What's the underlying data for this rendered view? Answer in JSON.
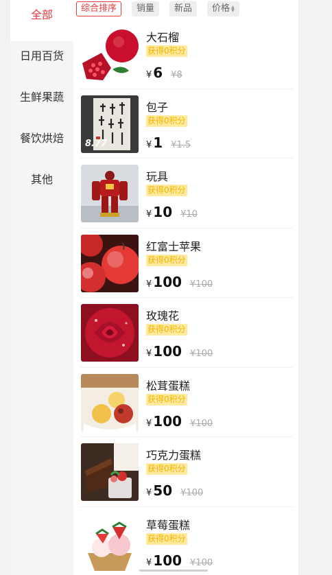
{
  "sidebar": {
    "categories": [
      {
        "label": "全部",
        "active": true
      },
      {
        "label": "日用百货",
        "active": false
      },
      {
        "label": "生鲜果蔬",
        "active": false
      },
      {
        "label": "餐饮烘焙",
        "active": false
      },
      {
        "label": "其他",
        "active": false
      }
    ]
  },
  "sortbar": {
    "options": [
      {
        "label": "综合排序",
        "active": true
      },
      {
        "label": "销量",
        "active": false
      },
      {
        "label": "新品",
        "active": false
      },
      {
        "label": "价格",
        "active": false,
        "has_arrows": true
      }
    ]
  },
  "currency_symbol": "¥",
  "products": [
    {
      "name": "大石榴",
      "points": "获得0积分",
      "price": "6",
      "old_price": "¥8",
      "thumb": "pomegranate-image"
    },
    {
      "name": "包子",
      "points": "获得0积分",
      "price": "1",
      "old_price": "¥1.5",
      "thumb": "calligraphy-image",
      "overlay": "8.77"
    },
    {
      "name": "玩具",
      "points": "获得0积分",
      "price": "10",
      "old_price": "¥10",
      "thumb": "robot-toy-image"
    },
    {
      "name": "红富士苹果",
      "points": "获得0积分",
      "price": "100",
      "old_price": "¥100",
      "thumb": "apple-image"
    },
    {
      "name": "玫瑰花",
      "points": "获得0积分",
      "price": "100",
      "old_price": "¥100",
      "thumb": "rose-image"
    },
    {
      "name": "松茸蛋糕",
      "points": "获得0积分",
      "price": "100",
      "old_price": "¥100",
      "thumb": "icecream-image"
    },
    {
      "name": "巧克力蛋糕",
      "points": "获得0积分",
      "price": "50",
      "old_price": "¥100",
      "thumb": "chocolate-cake-image"
    },
    {
      "name": "草莓蛋糕",
      "points": "获得0积分",
      "price": "100",
      "old_price": "¥100",
      "thumb": "strawberry-cake-image"
    }
  ],
  "colors": {
    "accent": "#e4393c",
    "points_bg": "#ffeaa0",
    "points_text": "#f5b400"
  }
}
